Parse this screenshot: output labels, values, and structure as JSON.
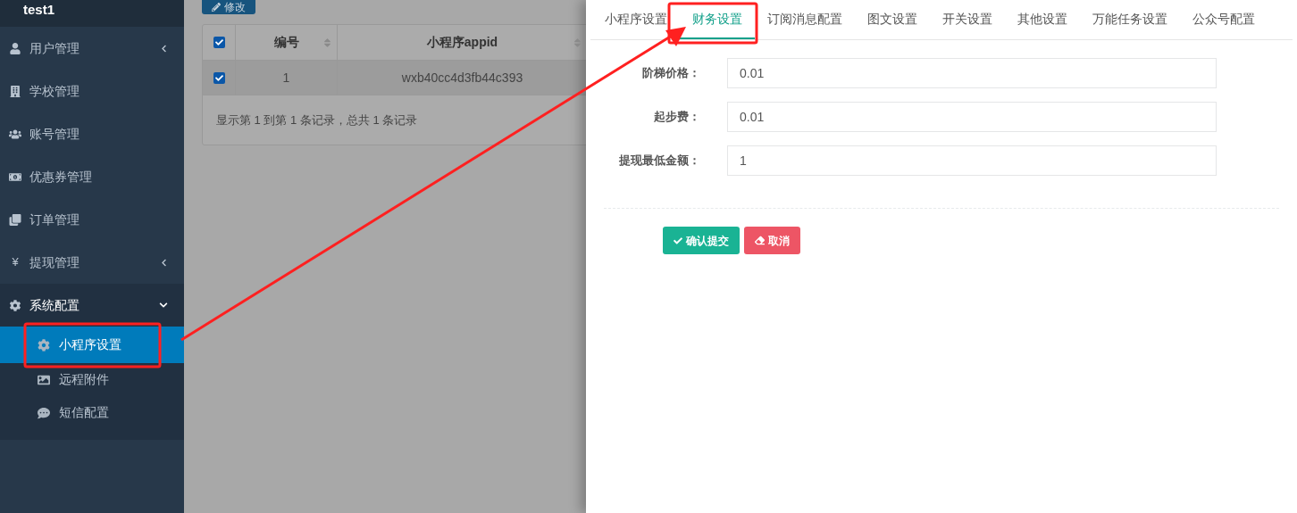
{
  "sidebar": {
    "brand": "test1",
    "items": [
      {
        "kind": "group",
        "label": "用户管理",
        "expanded": false
      },
      {
        "kind": "link",
        "label": "学校管理"
      },
      {
        "kind": "link",
        "label": "账号管理"
      },
      {
        "kind": "link",
        "label": "优惠券管理"
      },
      {
        "kind": "link",
        "label": "订单管理"
      },
      {
        "kind": "group",
        "label": "提现管理",
        "icon_text": "¥",
        "expanded": false
      },
      {
        "kind": "group",
        "label": "系统配置",
        "expanded": true,
        "children": [
          {
            "label": "小程序设置",
            "selected": true
          },
          {
            "label": "远程附件",
            "selected": false
          },
          {
            "label": "短信配置",
            "selected": false
          }
        ]
      }
    ]
  },
  "toolbar": {
    "edit_button": "修改"
  },
  "table": {
    "header_checked": true,
    "columns": [
      "编号",
      "小程序appid"
    ],
    "rows": [
      {
        "checked": true,
        "selected": true,
        "cells": [
          "1",
          "wxb40cc4d3fb44c393"
        ]
      }
    ],
    "footer": "显示第 1 到第 1 条记录，总共 1 条记录"
  },
  "panel": {
    "tabs": [
      {
        "label": "小程序设置",
        "selected": false
      },
      {
        "label": "财务设置",
        "selected": true
      },
      {
        "label": "订阅消息配置",
        "selected": false
      },
      {
        "label": "图文设置",
        "selected": false
      },
      {
        "label": "开关设置",
        "selected": false
      },
      {
        "label": "其他设置",
        "selected": false
      },
      {
        "label": "万能任务设置",
        "selected": false
      },
      {
        "label": "公众号配置",
        "selected": false
      }
    ],
    "fields": [
      {
        "label": "阶梯价格：",
        "value": "0.01"
      },
      {
        "label": "起步费：",
        "value": "0.01"
      },
      {
        "label": "提现最低金额：",
        "value": "1"
      }
    ],
    "submit_button": "确认提交",
    "cancel_button": "取消"
  }
}
